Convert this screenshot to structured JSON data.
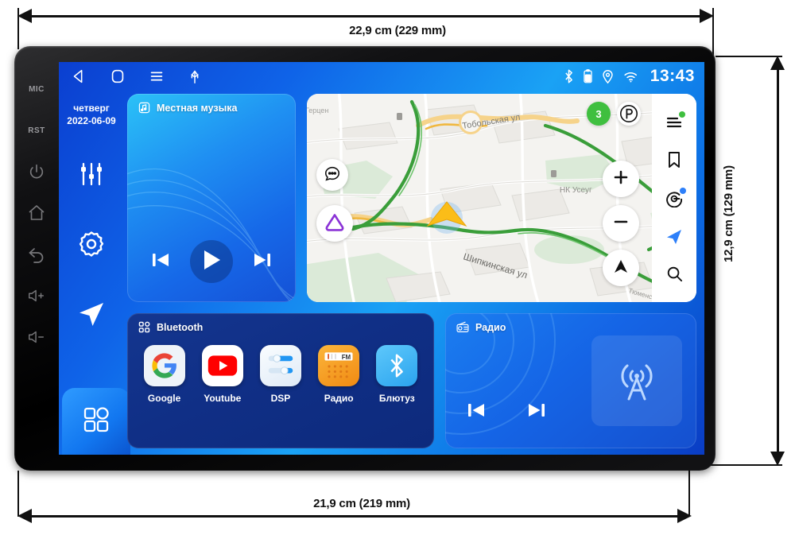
{
  "dimensions": {
    "top": "22,9 cm (229 mm)",
    "bottom": "21,9 cm (219 mm)",
    "right": "12,9 cm (129 mm)"
  },
  "bezel": {
    "mic_label": "MIC",
    "rst_label": "RST",
    "buttons": [
      "power-icon",
      "home-icon",
      "back-icon",
      "volume-up-icon",
      "volume-down-icon"
    ]
  },
  "statusbar": {
    "nav": [
      "back-icon",
      "home-icon",
      "recents-icon",
      "usb-icon"
    ],
    "indicators": [
      "bluetooth-icon",
      "battery-icon",
      "location-icon",
      "wifi-icon"
    ],
    "clock": "13:43"
  },
  "rail": {
    "weekday": "четверг",
    "date": "2022-06-09",
    "items": [
      {
        "name": "equalizer-icon"
      },
      {
        "name": "settings-gear-icon"
      },
      {
        "name": "navigation-arrow-icon"
      },
      {
        "name": "apps-grid-icon"
      }
    ]
  },
  "music": {
    "title": "Местная музыка",
    "icon": "music-note-icon",
    "controls": [
      "previous-track-icon",
      "play-icon",
      "next-track-icon"
    ]
  },
  "map": {
    "traffic_level": "3",
    "parking_label": "P",
    "streets": [
      "Тобольская ул",
      "Шипкинская ул",
      "Тюменская ул"
    ],
    "pois": [
      "НК Усеуг",
      "НК",
      "Герцен"
    ],
    "toolbar": [
      {
        "name": "menu-icon",
        "dot": "#3fbf3f"
      },
      {
        "name": "bookmark-icon",
        "dot": ""
      },
      {
        "name": "yandex-plus-icon",
        "dot": "#2d7ff9"
      },
      {
        "name": "navigation-arrow-icon",
        "dot": ""
      },
      {
        "name": "search-icon",
        "dot": ""
      }
    ],
    "fabs": [
      "chat-bubble-icon",
      "alice-triangle-icon",
      "zoom-in-icon",
      "zoom-out-icon",
      "compass-icon"
    ],
    "accent_green": "#3a9e3a",
    "accent_yellow": "#f0a830",
    "marker_color": "#fbbd18"
  },
  "dock": {
    "title": "Bluetooth",
    "icon": "apps-grid-icon",
    "apps": [
      {
        "label": "Google",
        "icon": "google-icon",
        "bg": "#eef3f8"
      },
      {
        "label": "Youtube",
        "icon": "youtube-icon",
        "bg": "#ffffff"
      },
      {
        "label": "DSP",
        "icon": "dsp-sliders-icon",
        "bg": "#eff5fb"
      },
      {
        "label": "Радио",
        "icon": "radio-fm-icon",
        "bg": "#f7a020"
      },
      {
        "label": "Блютуз",
        "icon": "bluetooth-icon",
        "bg": "#3db8f5"
      }
    ]
  },
  "radio": {
    "title": "Радио",
    "icon": "radio-tower-icon",
    "controls": [
      "previous-station-icon",
      "next-station-icon"
    ],
    "art_icon": "radio-tower-icon"
  }
}
